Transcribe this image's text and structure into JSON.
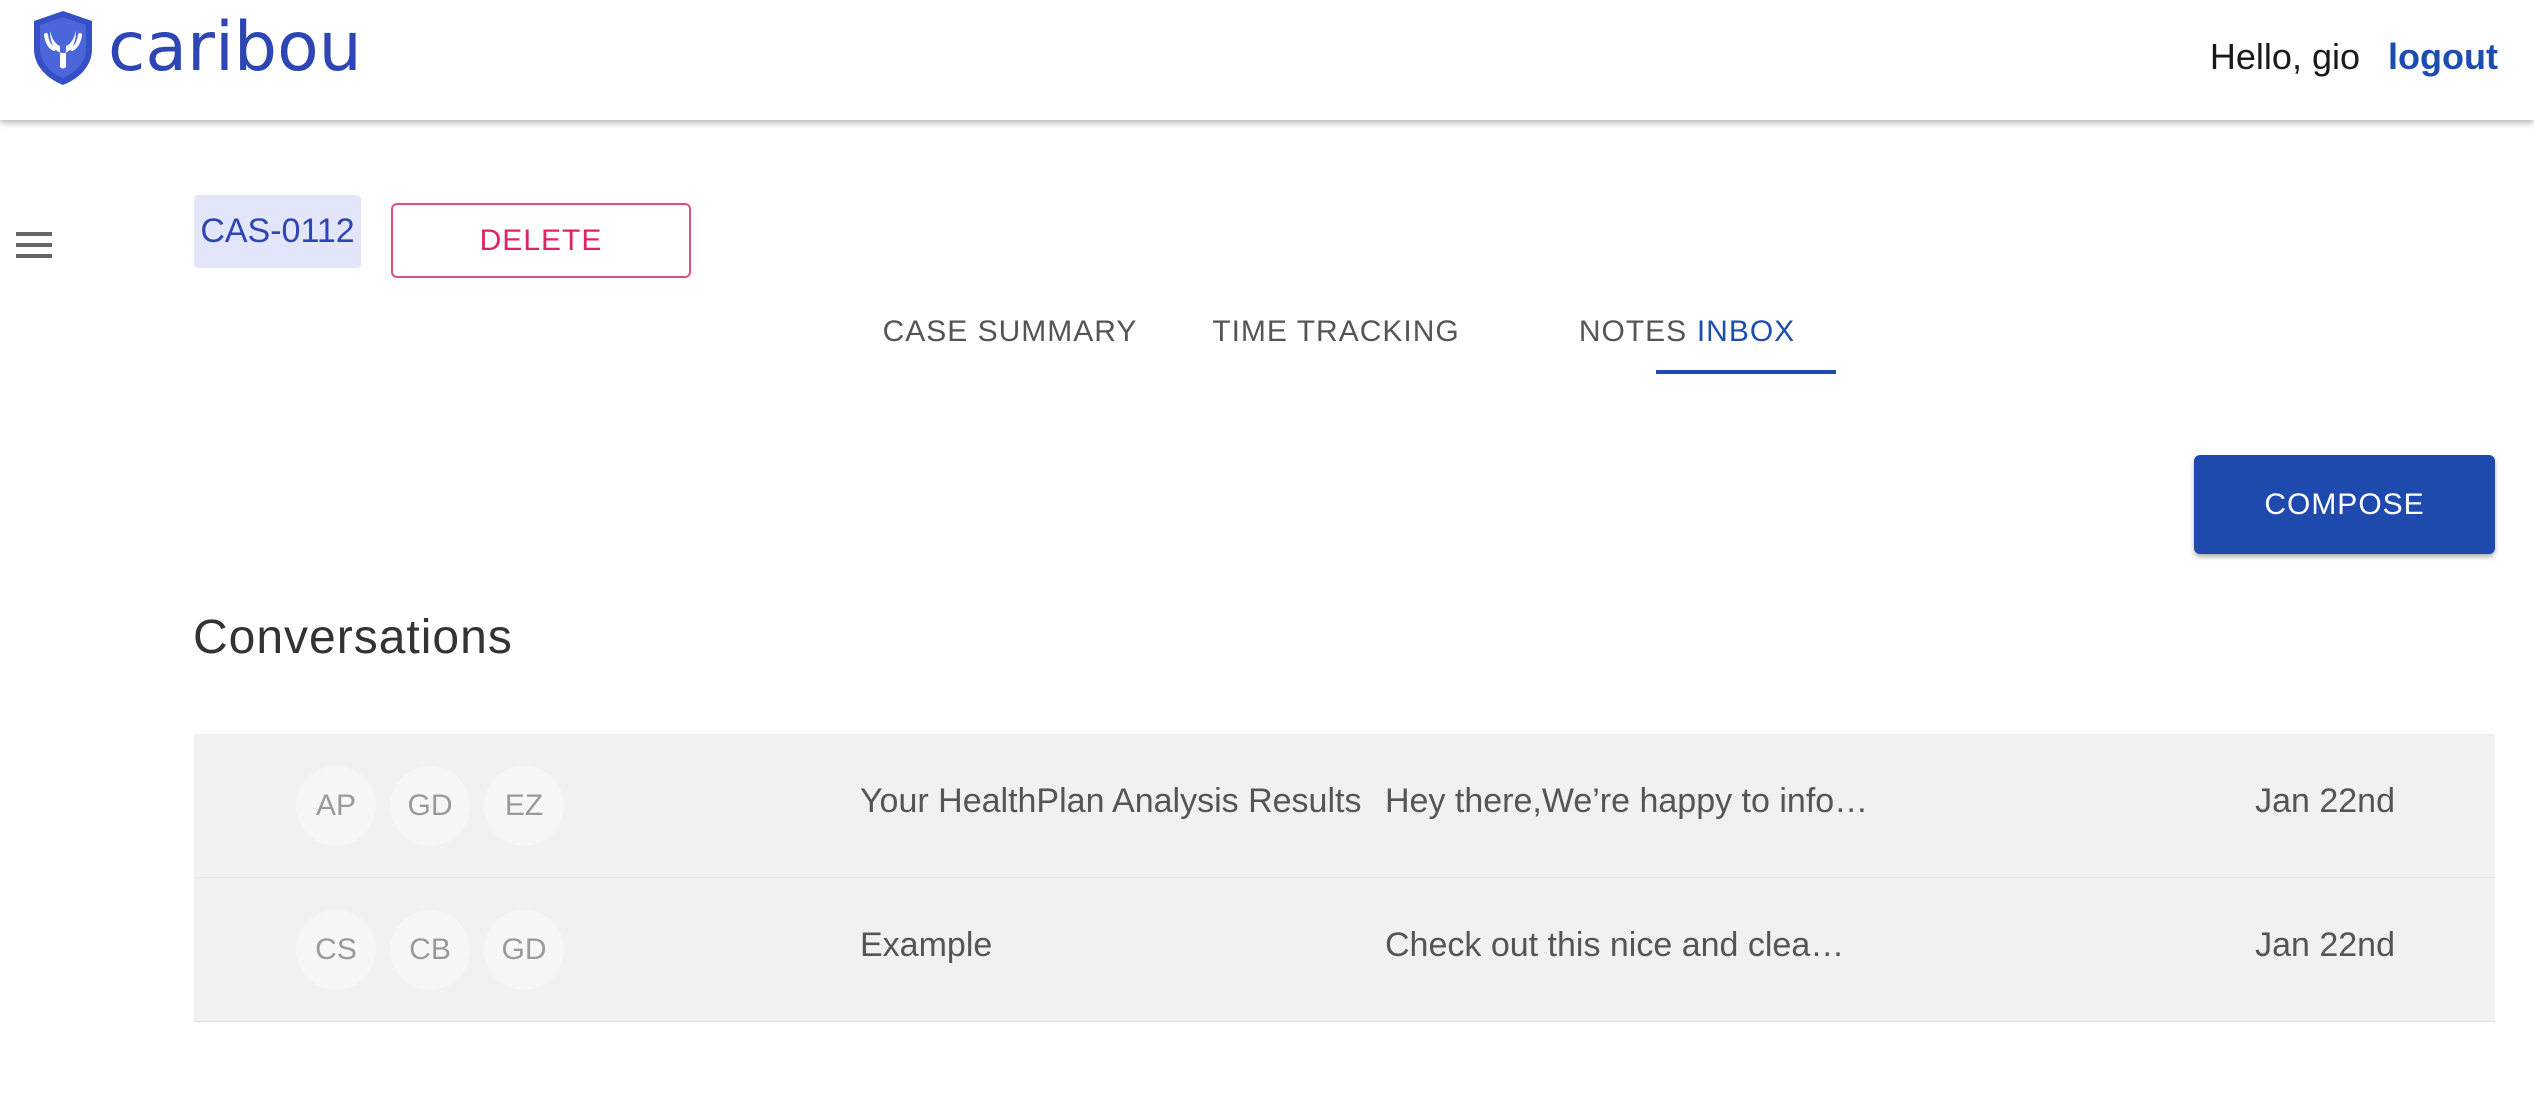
{
  "header": {
    "brand": "caribou",
    "greeting": "Hello, gio",
    "logout_label": "logout"
  },
  "case": {
    "id": "CAS-0112",
    "delete_label": "DELETE"
  },
  "tabs": [
    {
      "label": "CASE SUMMARY",
      "active": false
    },
    {
      "label": "TIME TRACKING",
      "active": false
    },
    {
      "label": "NOTES",
      "active": false
    },
    {
      "label": "INBOX",
      "active": true
    }
  ],
  "compose_label": "COMPOSE",
  "conversations": {
    "title": "Conversations",
    "rows": [
      {
        "participants": [
          "AP",
          "GD",
          "EZ"
        ],
        "subject": "Your HealthPlan Analysis Results",
        "preview": "Hey there,We’re happy to info…",
        "date": "Jan 22nd"
      },
      {
        "participants": [
          "CS",
          "CB",
          "GD"
        ],
        "subject": "Example",
        "preview": "Check out this nice and clea…",
        "date": "Jan 22nd"
      }
    ]
  },
  "colors": {
    "brand": "#2e46b3",
    "primary": "#1f4aad",
    "danger": "#e0245e",
    "badge_bg": "#e3e6fb",
    "row_bg": "#f1f1f1"
  },
  "icons": {
    "logo": "caribou-shield-logo-icon",
    "menu": "hamburger-menu-icon"
  }
}
